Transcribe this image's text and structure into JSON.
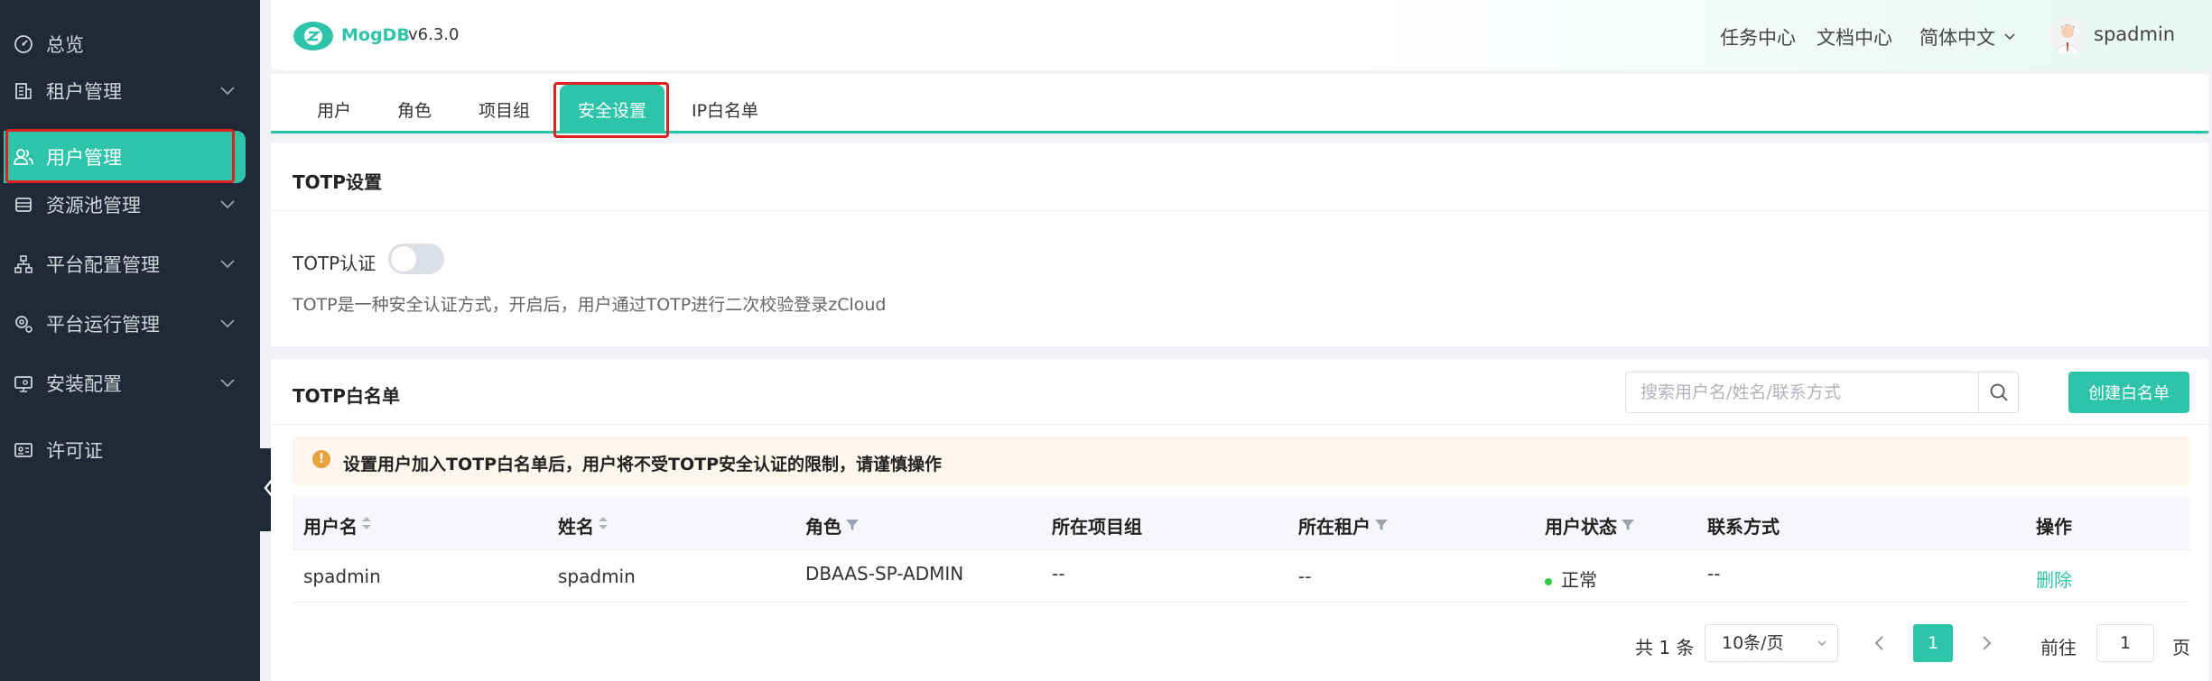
{
  "sidebar": {
    "items": [
      {
        "label": "总览",
        "icon": "dashboard-icon"
      },
      {
        "label": "租户管理",
        "icon": "building-icon"
      },
      {
        "label": "用户管理",
        "icon": "users-icon",
        "active": true
      },
      {
        "label": "资源池管理",
        "icon": "database-icon"
      },
      {
        "label": "平台配置管理",
        "icon": "sitemap-icon"
      },
      {
        "label": "平台运行管理",
        "icon": "gear-icon"
      },
      {
        "label": "安装配置",
        "icon": "monitor-icon"
      },
      {
        "label": "许可证",
        "icon": "license-icon"
      }
    ]
  },
  "header": {
    "logo": "MogDB",
    "version": "v6.3.0",
    "links": [
      "任务中心",
      "文档中心"
    ],
    "language": "简体中文",
    "user": "spadmin"
  },
  "tabs": [
    "用户",
    "角色",
    "项目组",
    "安全设置",
    "IP白名单"
  ],
  "totp": {
    "title": "TOTP设置",
    "auth_label": "TOTP认证",
    "enabled": false,
    "description": "TOTP是一种安全认证方式，开启后，用户通过TOTP进行二次校验登录zCloud"
  },
  "whitelist": {
    "title": "TOTP白名单",
    "search_placeholder": "搜索用户名/姓名/联系方式",
    "create_label": "创建白名单",
    "notice": "设置用户加入TOTP白名单后，用户将不受TOTP安全认证的限制，请谨慎操作",
    "columns": [
      "用户名",
      "姓名",
      "角色",
      "所在项目组",
      "所在租户",
      "用户状态",
      "联系方式",
      "操作"
    ],
    "rows": [
      {
        "username": "spadmin",
        "name": "spadmin",
        "role": "DBAAS-SP-ADMIN",
        "project": "--",
        "tenant": "--",
        "status": "正常",
        "contact": "--",
        "action": "删除"
      }
    ]
  },
  "pagination": {
    "total": "共 1 条",
    "page_size": "10条/页",
    "current_page": "1",
    "goto_label": "前往",
    "goto_value": "1",
    "page_unit": "页"
  },
  "colors": {
    "accent": "#2ec4a9",
    "sidebar": "#1f2937",
    "highlight": "#e02020",
    "warning": "#e6a23c"
  }
}
